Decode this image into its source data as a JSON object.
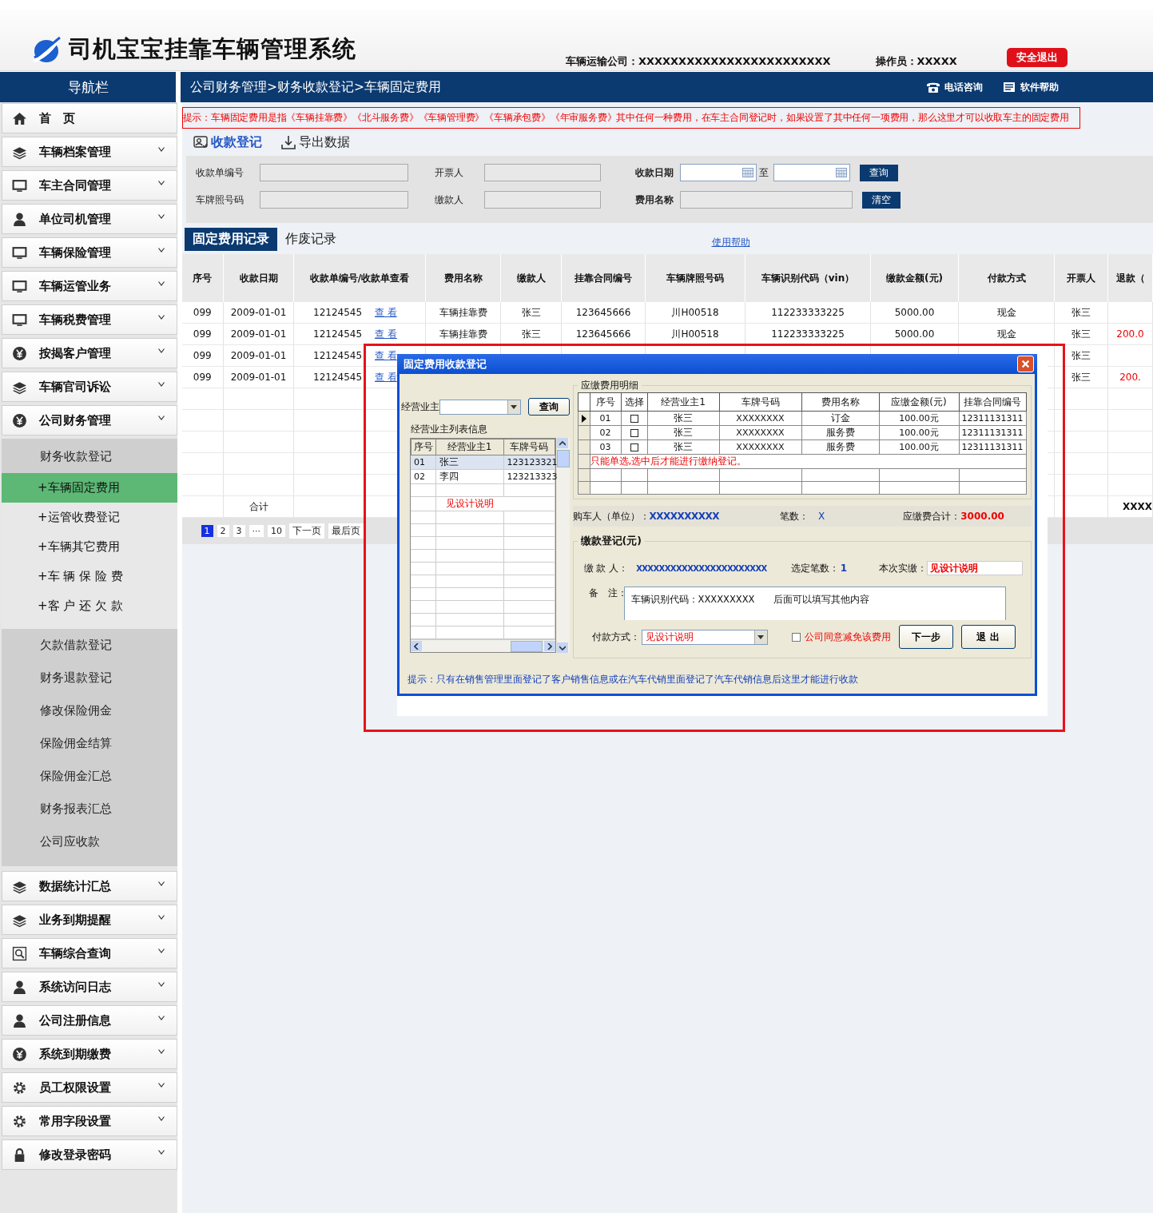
{
  "header": {
    "title": "司机宝宝挂靠车辆管理系统",
    "company": "车辆运输公司：XXXXXXXXXXXXXXXXXXXXXXXX",
    "operator": "操作员：XXXXX",
    "logout_button": "安全退出"
  },
  "nav": {
    "title": "导航栏",
    "breadcrumb": "公司财务管理>财务收款登记>车辆固定费用",
    "links": [
      {
        "kind": "phone",
        "label": "电话咨询"
      },
      {
        "kind": "help",
        "label": "软件帮助"
      }
    ]
  },
  "sidebar": {
    "items": [
      {
        "kind": "home",
        "label": "首　页"
      },
      {
        "kind": "layers",
        "label": "车辆档案管理"
      },
      {
        "kind": "monitor",
        "label": "车主合同管理"
      },
      {
        "kind": "person",
        "label": "单位司机管理"
      },
      {
        "kind": "monitor",
        "label": "车辆保险管理"
      },
      {
        "kind": "monitor",
        "label": "车辆运管业务"
      },
      {
        "kind": "monitor",
        "label": "车辆税费管理"
      },
      {
        "kind": "yen",
        "label": "按揭客户管理"
      },
      {
        "kind": "layers",
        "label": "车辆官司诉讼"
      },
      {
        "kind": "yen",
        "label": "公司财务管理",
        "expanded": true,
        "children": [
          {
            "label": "财务收款登记",
            "selected": false,
            "expanded": true,
            "children": [
              {
                "label": "+车辆固定费用",
                "selected": true
              },
              {
                "label": "+运管收费登记",
                "selected": false
              },
              {
                "label": "+车辆其它费用",
                "selected": false
              },
              {
                "label": "+车 辆 保 险 费",
                "selected": false
              },
              {
                "label": "+客 户 还 欠 款",
                "selected": false
              }
            ]
          },
          {
            "label": "欠款借款登记",
            "selected": false
          },
          {
            "label": "财务退款登记",
            "selected": false
          },
          {
            "label": "修改保险佣金",
            "selected": false
          },
          {
            "label": "保险佣金结算",
            "selected": false
          },
          {
            "label": "保险佣金汇总",
            "selected": false
          },
          {
            "label": "财务报表汇总",
            "selected": false
          },
          {
            "label": "公司应收款",
            "selected": false
          }
        ]
      },
      {
        "kind": "layers",
        "label": "数据统计汇总"
      },
      {
        "kind": "layers",
        "label": "业务到期提醒"
      },
      {
        "kind": "search",
        "label": "车辆综合查询"
      },
      {
        "kind": "person",
        "label": "系统访问日志"
      },
      {
        "kind": "person",
        "label": "公司注册信息"
      },
      {
        "kind": "yen",
        "label": "系统到期缴费"
      },
      {
        "kind": "gear",
        "label": "员工权限设置"
      },
      {
        "kind": "gear",
        "label": "常用字段设置"
      },
      {
        "kind": "lock",
        "label": "修改登录密码"
      }
    ]
  },
  "notice": "提示：车辆固定费用是指《车辆挂靠费》《北斗服务费》《车辆管理费》《车辆承包费》《年审服务费》其中任何一种费用，在车主合同登记时，如果设置了其中任何一项费用，那么这里才可以收取车主的固定费用",
  "toolbar": [
    {
      "kind": "register",
      "label": "收款登记"
    },
    {
      "kind": "export",
      "label": "导出数据"
    }
  ],
  "filters": {
    "fields": [
      {
        "kind": "text",
        "label": "收款单编号"
      },
      {
        "kind": "text",
        "label": "开票人"
      },
      {
        "kind": "date",
        "label": "收款日期",
        "separator": "至"
      },
      {
        "kind": "text",
        "label": "车牌照号码"
      },
      {
        "kind": "text",
        "label": "缴款人"
      },
      {
        "kind": "text",
        "label": "费用名称"
      }
    ],
    "buttons": [
      "查询",
      "清空"
    ]
  },
  "tabs": [
    {
      "label": "固定费用记录",
      "selected": true
    },
    {
      "label": "作废记录",
      "selected": false
    }
  ],
  "help_link": "使用帮助",
  "table": {
    "columns": [
      "序号",
      "收款日期",
      "收款单编号/收款单查看",
      "费用名称",
      "缴款人",
      "挂靠合同编号",
      "车辆牌照号码",
      "车辆识别代码（vin）",
      "缴款金额(元)",
      "付款方式",
      "开票人",
      "退款（"
    ],
    "rows": [
      {
        "no": "099",
        "date": "2009-01-01",
        "receipt": "12124545",
        "view_link": "查 看",
        "fee_name": "车辆挂靠费",
        "payer": "张三",
        "contract_no": "123645666",
        "plate": "川H00518",
        "vin": "112233333225",
        "amount": "5000.00",
        "pay_method": "现金",
        "issuer": "张三"
      },
      {
        "no": "099",
        "date": "2009-01-01",
        "receipt": "12124545",
        "view_link": "查 看",
        "fee_name": "车辆挂靠费",
        "payer": "张三",
        "contract_no": "123645666",
        "plate": "川H00518",
        "vin": "112233333225",
        "amount": "5000.00",
        "pay_method": "现金",
        "issuer": "张三",
        "refund": "200.0"
      },
      {
        "no": "099",
        "date": "2009-01-01",
        "receipt": "12124545",
        "view_link": "查 看",
        "issuer": "张三"
      },
      {
        "no": "099",
        "date": "2009-01-01",
        "receipt": "12124545",
        "view_link": "查 看",
        "issuer": "张三",
        "refund": "200."
      }
    ],
    "total": {
      "label": "合计",
      "refund": "XXXX"
    }
  },
  "pagination": {
    "pages": [
      {
        "label": "1",
        "selected": true
      },
      {
        "label": "2",
        "selected": false
      },
      {
        "label": "3",
        "selected": false
      },
      {
        "label": "···",
        "selected": false
      },
      {
        "label": "10",
        "selected": false
      }
    ],
    "next": "下一页",
    "last": "最后页"
  },
  "dialog": {
    "title": "固定费用收款登记",
    "owner_filter": {
      "label": "经营业主",
      "button": "查询"
    },
    "owners": {
      "title": "经营业主列表信息",
      "columns": [
        "序号",
        "经营业主1",
        "车牌号码"
      ],
      "rows": [
        {
          "no": "01",
          "name": "张三",
          "plate": "123123321",
          "selected": true
        },
        {
          "no": "02",
          "name": "李四",
          "plate": "123213323",
          "selected": false
        }
      ],
      "note": "见设计说明"
    },
    "fees": {
      "title": "应缴费用明细",
      "columns": [
        "序号",
        "选择",
        "经营业主1",
        "车牌号码",
        "费用名称",
        "应缴金额(元)",
        "挂靠合同编号"
      ],
      "rows": [
        {
          "no": "01",
          "checked": false,
          "current": true,
          "owner": "张三",
          "plate": "XXXXXXXX",
          "fee_name": "订金",
          "amount": "100.00元",
          "contract_no": "12311131311"
        },
        {
          "no": "02",
          "checked": false,
          "current": false,
          "owner": "张三",
          "plate": "XXXXXXXX",
          "fee_name": "服务费",
          "amount": "100.00元",
          "contract_no": "12311131311"
        },
        {
          "no": "03",
          "checked": false,
          "current": false,
          "owner": "张三",
          "plate": "XXXXXXXX",
          "fee_name": "服务费",
          "amount": "100.00元",
          "contract_no": "12311131311"
        }
      ],
      "note": "只能单选,选中后才能进行缴纳登记。"
    },
    "summary": {
      "buyer_label": "购车人（单位）：",
      "buyer": "XXXXXXXXXX",
      "count_label": "笔数：",
      "count": "X",
      "total_label": "应缴费合计：",
      "total": "3000.00"
    },
    "payment": {
      "title": "缴款登记(元)",
      "payer_label": "缴 款 人：",
      "payer": "XXXXXXXXXXXXXXXXXXXXXXX",
      "selected_label": "选定笔数：",
      "selected_count": "1",
      "paid_label": "本次实缴：",
      "paid_value": "见设计说明",
      "remark_label": "备　注：",
      "remark": "车辆识别代码：XXXXXXXXX　　后面可以填写其他内容",
      "method_label": "付款方式：",
      "method_value": "见设计说明",
      "waive_label": "公司同意减免该费用",
      "waive_checked": false,
      "buttons": [
        "下一步",
        "退 出"
      ]
    },
    "hint": "提示：只有在销售管理里面登记了客户销售信息或在汽车代销里面登记了汽车代销信息后这里才能进行收款"
  }
}
